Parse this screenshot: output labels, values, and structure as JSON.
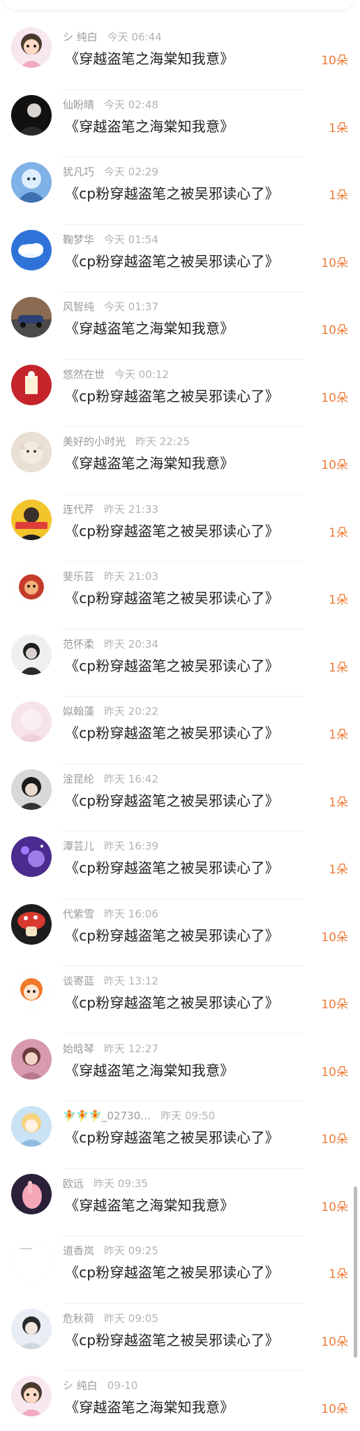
{
  "colors": {
    "accent": "#f07c37",
    "name_text": "#9a9a9a",
    "title_text": "#1f1f1f",
    "scrollbar": "#bdbdbd"
  },
  "rows": [
    {
      "name": "シ 纯白",
      "time": "今天 06:44",
      "title": "《穿越盗笔之海棠知我意》",
      "amount": "10朵",
      "avatar": "cartoon-girl"
    },
    {
      "name": "仙盼晴",
      "time": "今天 02:48",
      "title": "《穿越盗笔之海棠知我意》",
      "amount": "1朵",
      "avatar": "dark-portrait"
    },
    {
      "name": "犹凡巧",
      "time": "今天 02:29",
      "title": "《cp粉穿越盗笔之被吴邪读心了》",
      "amount": "1朵",
      "avatar": "blue-anime"
    },
    {
      "name": "鞠梦华",
      "time": "今天 01:54",
      "title": "《cp粉穿越盗笔之被吴邪读心了》",
      "amount": "10朵",
      "avatar": "sky-cloud"
    },
    {
      "name": "风智纯",
      "time": "今天 01:37",
      "title": "《穿越盗笔之海棠知我意》",
      "amount": "10朵",
      "avatar": "car"
    },
    {
      "name": "悠然在世",
      "time": "今天 00:12",
      "title": "《cp粉穿越盗笔之被吴邪读心了》",
      "amount": "10朵",
      "avatar": "red-festival"
    },
    {
      "name": "美好的小时光",
      "time": "昨天 22:25",
      "title": "《穿越盗笔之海棠知我意》",
      "amount": "10朵",
      "avatar": "cat"
    },
    {
      "name": "连代芹",
      "time": "昨天 21:33",
      "title": "《cp粉穿越盗笔之被吴邪读心了》",
      "amount": "1朵",
      "avatar": "yellow-banner"
    },
    {
      "name": "斐乐芸",
      "time": "昨天 21:03",
      "title": "《cp粉穿越盗笔之被吴邪读心了》",
      "amount": "1朵",
      "avatar": "red-lion"
    },
    {
      "name": "范怀柔",
      "time": "昨天 20:34",
      "title": "《cp粉穿越盗笔之被吴邪读心了》",
      "amount": "1朵",
      "avatar": "girl-bw"
    },
    {
      "name": "姒翰藻",
      "time": "昨天 20:22",
      "title": "《cp粉穿越盗笔之被吴邪读心了》",
      "amount": "1朵",
      "avatar": "pink-soft"
    },
    {
      "name": "淦昆纶",
      "time": "昨天 16:42",
      "title": "《cp粉穿越盗笔之被吴邪读心了》",
      "amount": "1朵",
      "avatar": "boy-dark"
    },
    {
      "name": "潭芸儿",
      "time": "昨天 16:39",
      "title": "《cp粉穿越盗笔之被吴邪读心了》",
      "amount": "1朵",
      "avatar": "purple-galaxy"
    },
    {
      "name": "代紫雪",
      "time": "昨天 16:06",
      "title": "《cp粉穿越盗笔之被吴邪读心了》",
      "amount": "10朵",
      "avatar": "mushroom"
    },
    {
      "name": "谈寄蓝",
      "time": "昨天 13:12",
      "title": "《cp粉穿越盗笔之被吴邪读心了》",
      "amount": "10朵",
      "avatar": "orange-hair"
    },
    {
      "name": "始晗琴",
      "time": "昨天 12:27",
      "title": "《穿越盗笔之海棠知我意》",
      "amount": "10朵",
      "avatar": "pink-girl"
    },
    {
      "name": "🧚🧚🧚_02730…",
      "time": "昨天 09:50",
      "title": "《cp粉穿越盗笔之被吴邪读心了》",
      "amount": "10朵",
      "avatar": "blonde-anime"
    },
    {
      "name": "欧远",
      "time": "昨天 09:35",
      "title": "《穿越盗笔之海棠知我意》",
      "amount": "10朵",
      "avatar": "hand-pink"
    },
    {
      "name": "道香岚",
      "time": "昨天 09:25",
      "title": "《cp粉穿越盗笔之被吴邪读心了》",
      "amount": "1朵",
      "avatar": "blank-white"
    },
    {
      "name": "危秋荷",
      "time": "昨天 09:05",
      "title": "《cp粉穿越盗笔之被吴邪读心了》",
      "amount": "10朵",
      "avatar": "boy-light"
    },
    {
      "name": "シ 纯白",
      "time": "09-10",
      "title": "《穿越盗笔之海棠知我意》",
      "amount": "10朵",
      "avatar": "cartoon-girl"
    }
  ]
}
